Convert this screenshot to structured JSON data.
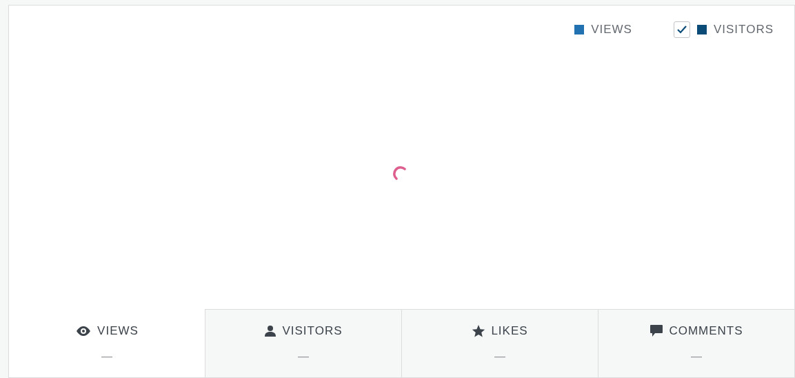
{
  "legend": [
    {
      "kind": "plain",
      "label": "VIEWS",
      "color": "#2271b1"
    },
    {
      "kind": "checkbox",
      "label": "VISITORS",
      "color": "#0a4b78",
      "checked": true
    }
  ],
  "chart": {
    "loading": true
  },
  "tabs": [
    {
      "kind": "eye",
      "label": "VIEWS",
      "value": "—",
      "selected": true
    },
    {
      "kind": "person",
      "label": "VISITORS",
      "value": "—",
      "selected": false
    },
    {
      "kind": "star",
      "label": "LIKES",
      "value": "—",
      "selected": false
    },
    {
      "kind": "comment",
      "label": "COMMENTS",
      "value": "—",
      "selected": false
    }
  ]
}
